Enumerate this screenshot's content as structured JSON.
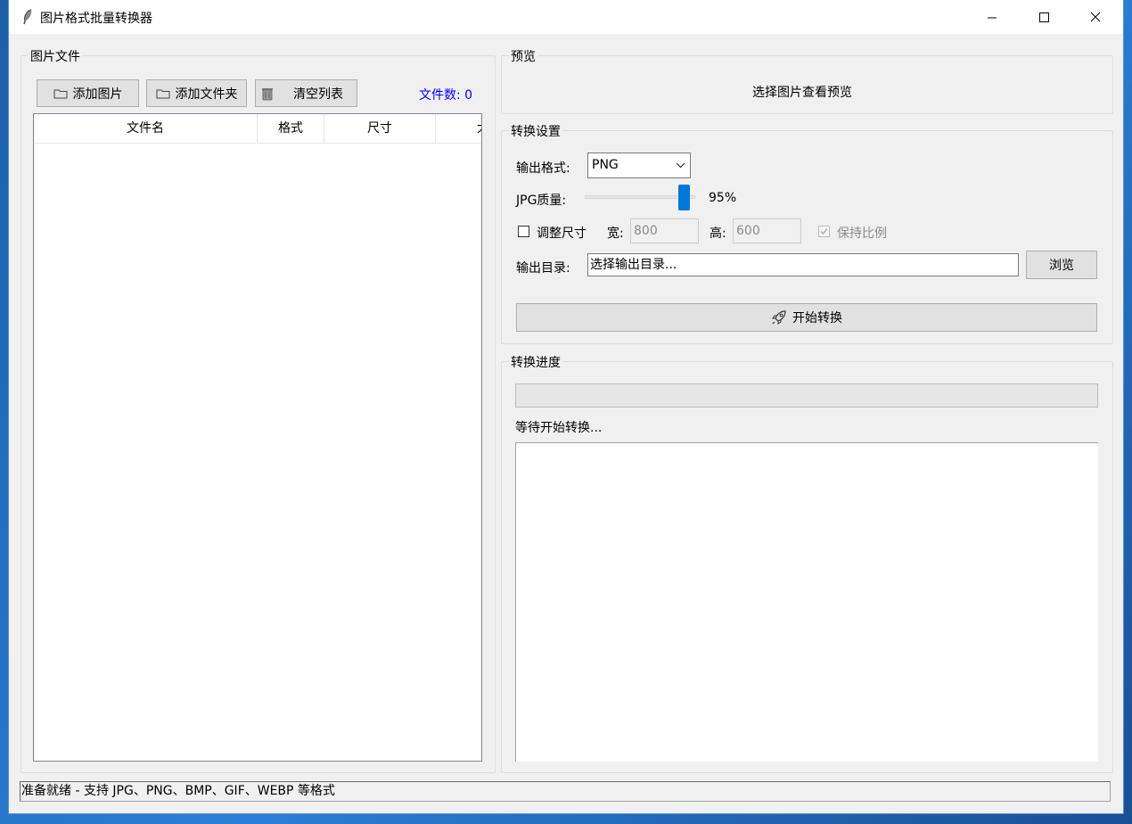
{
  "window": {
    "title": "图片格式批量转换器"
  },
  "file_panel": {
    "title": "图片文件",
    "buttons": {
      "add_images": "添加图片",
      "add_folder": "添加文件夹",
      "clear_list": "清空列表"
    },
    "file_count": "文件数: 0",
    "columns": [
      "文件名",
      "格式",
      "尺寸",
      "大小"
    ]
  },
  "preview": {
    "title": "预览",
    "placeholder": "选择图片查看预览"
  },
  "settings": {
    "title": "转换设置",
    "output_format_label": "输出格式:",
    "output_format_value": "PNG",
    "jpg_quality_label": "JPG质量:",
    "jpg_quality_value": 95,
    "jpg_quality_text": "95%",
    "resize_label": "调整尺寸",
    "resize_checked": false,
    "width_label": "宽:",
    "width_value": "800",
    "height_label": "高:",
    "height_value": "600",
    "keep_ratio_label": "保持比例",
    "keep_ratio_checked": true,
    "output_dir_label": "输出目录:",
    "output_dir_value": "选择输出目录...",
    "browse_label": "浏览",
    "start_label": "开始转换"
  },
  "progress": {
    "title": "转换进度",
    "value_percent": 0,
    "status_text": "等待开始转换...",
    "log_text": ""
  },
  "statusbar": {
    "text": "准备就绪 - 支持 JPG、PNG、BMP、GIF、WEBP 等格式"
  },
  "colors": {
    "accent": "#0078d7",
    "file_count": "#0000ff"
  },
  "icons": [
    "feather-icon",
    "folder-icon",
    "trash-icon",
    "rocket-icon",
    "minimize-icon",
    "maximize-icon",
    "close-icon",
    "chevron-down-icon",
    "checkmark-icon"
  ]
}
